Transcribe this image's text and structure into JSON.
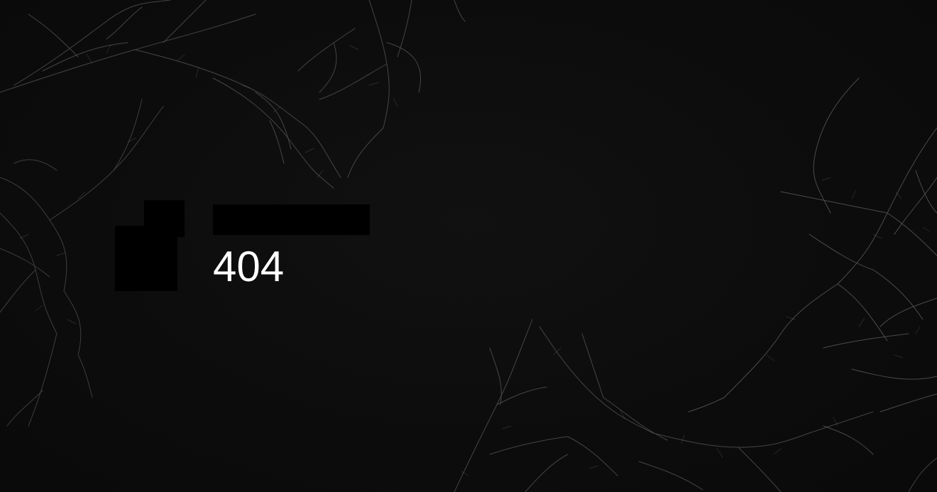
{
  "error": {
    "code": "404"
  },
  "colors": {
    "background": "#0d0d0d",
    "branch_stroke": "#8a8a8a",
    "text": "#ffffff",
    "redaction": "#000000"
  },
  "decor": {
    "background_art": "dendrite-branches"
  }
}
